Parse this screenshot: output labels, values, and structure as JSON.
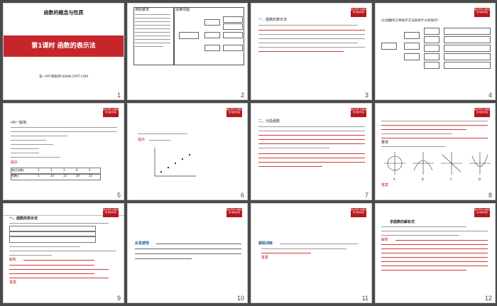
{
  "slide1": {
    "title": "函数的概念与性质",
    "subtitle": "第1课时  函数的表示法",
    "footer": "第一PPT模板网-WWW.1PPT.COM",
    "number": "1"
  },
  "tag_text": "图文导学 基础自测 规范作答",
  "slides": [
    {
      "number": "2",
      "top_left": "课标要求",
      "top_right": "思维导图"
    },
    {
      "number": "3",
      "heading": "一、函数的表示法",
      "hint": "提示"
    },
    {
      "number": "4",
      "lead": "(2)函数的三种表示方法各有什么优缺点？"
    },
    {
      "number": "5",
      "heading": "(4)一般地",
      "hint": "提示"
    },
    {
      "number": "6",
      "hint": "提示"
    },
    {
      "number": "7",
      "heading": "二、分段函数"
    },
    {
      "number": "8",
      "heading": "要求",
      "answer": "答案"
    },
    {
      "number": "9",
      "title": "一、函数的表示法",
      "hint": "解析",
      "answer": "答案"
    },
    {
      "number": "10",
      "label": "反思感悟"
    },
    {
      "number": "11",
      "label": "跟踪训练",
      "answer": "答案"
    },
    {
      "number": "12",
      "label": "求函数的解析式",
      "hint": "解析"
    }
  ],
  "s5_table": {
    "header": [
      "笔记本数x",
      "1",
      "2",
      "3",
      "4",
      "5"
    ],
    "row": [
      "钱数y",
      "5",
      "10",
      "15",
      "20",
      "25"
    ]
  },
  "s8_options": [
    "A",
    "B",
    "C",
    "D"
  ]
}
